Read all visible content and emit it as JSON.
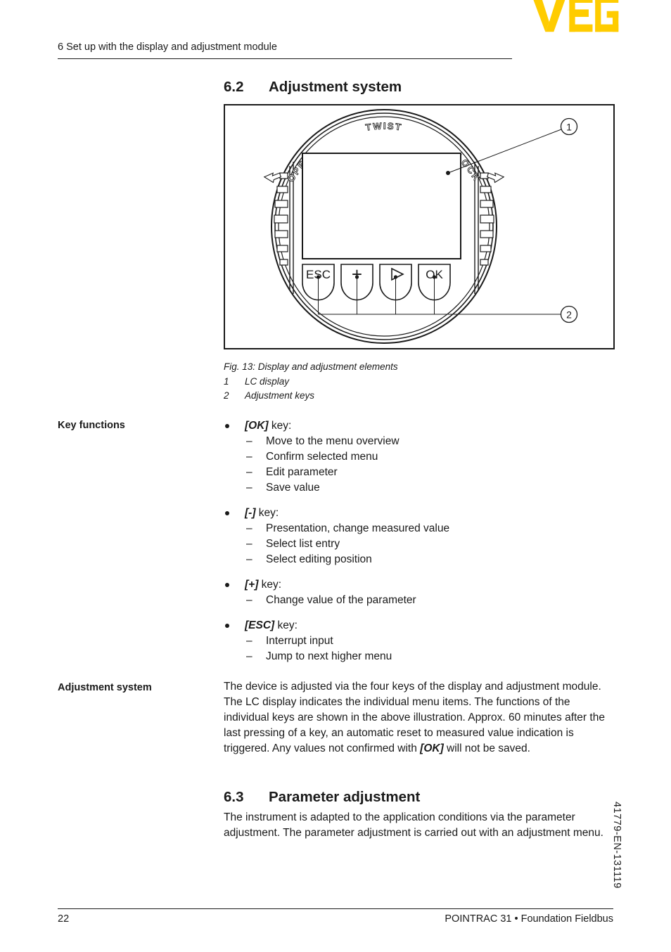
{
  "header": {
    "chapter_title": "6 Set up with the display and adjustment module",
    "logo_text": "VEGA",
    "logo_color": "#FFCC00"
  },
  "sections": {
    "adjustment_system": {
      "number": "6.2",
      "title": "Adjustment system"
    },
    "parameter_adjustment": {
      "number": "6.3",
      "title": "Parameter adjustment",
      "paragraph": "The instrument is adapted to the application conditions via the parameter adjustment. The parameter adjustment is carried out with an adjustment menu."
    }
  },
  "figure": {
    "caption": "Fig. 13: Display and adjustment elements",
    "legend": [
      {
        "num": "1",
        "text": "LC display"
      },
      {
        "num": "2",
        "text": "Adjustment keys"
      }
    ],
    "dial_labels": {
      "top": "TWIST",
      "left": "OPEN",
      "right": "LOCK"
    },
    "keys": [
      {
        "name": "esc-key",
        "label": "ESC"
      },
      {
        "name": "plus-key",
        "label": "+"
      },
      {
        "name": "arrow-key",
        "label": "▷"
      },
      {
        "name": "ok-key",
        "label": "OK"
      }
    ],
    "callouts": [
      {
        "num": "1",
        "target": "lc-display"
      },
      {
        "num": "2",
        "target": "adjustment-keys"
      }
    ]
  },
  "margin_labels": {
    "key_functions": "Key functions",
    "adjustment_system": "Adjustment system"
  },
  "key_functions": [
    {
      "key": "[OK]",
      "suffix": " key:",
      "items": [
        "Move to the menu overview",
        "Confirm selected menu",
        "Edit parameter",
        "Save value"
      ]
    },
    {
      "key": "[-]",
      "suffix": " key:",
      "items": [
        "Presentation, change measured value",
        "Select list entry",
        "Select editing position"
      ]
    },
    {
      "key": "[+]",
      "suffix": " key:",
      "items": [
        "Change value of the parameter"
      ]
    },
    {
      "key": "[ESC]",
      "suffix": " key:",
      "items": [
        "Interrupt input",
        "Jump to next higher menu"
      ]
    }
  ],
  "adjustment_system_paragraph": {
    "part1": "The device is adjusted via the four keys of the display and adjustment module. The LC display indicates the individual menu items. The functions of the individual keys are shown in the above illustration. Approx. 60 minutes after the last pressing of a key, an automatic reset to measured value indication is triggered. Any values not confirmed with ",
    "emphasis": "[OK]",
    "part2": " will not be saved."
  },
  "footer": {
    "page_number": "22",
    "product": "POINTRAC 31 • Foundation Fieldbus",
    "document_number": "41779-EN-131119"
  }
}
